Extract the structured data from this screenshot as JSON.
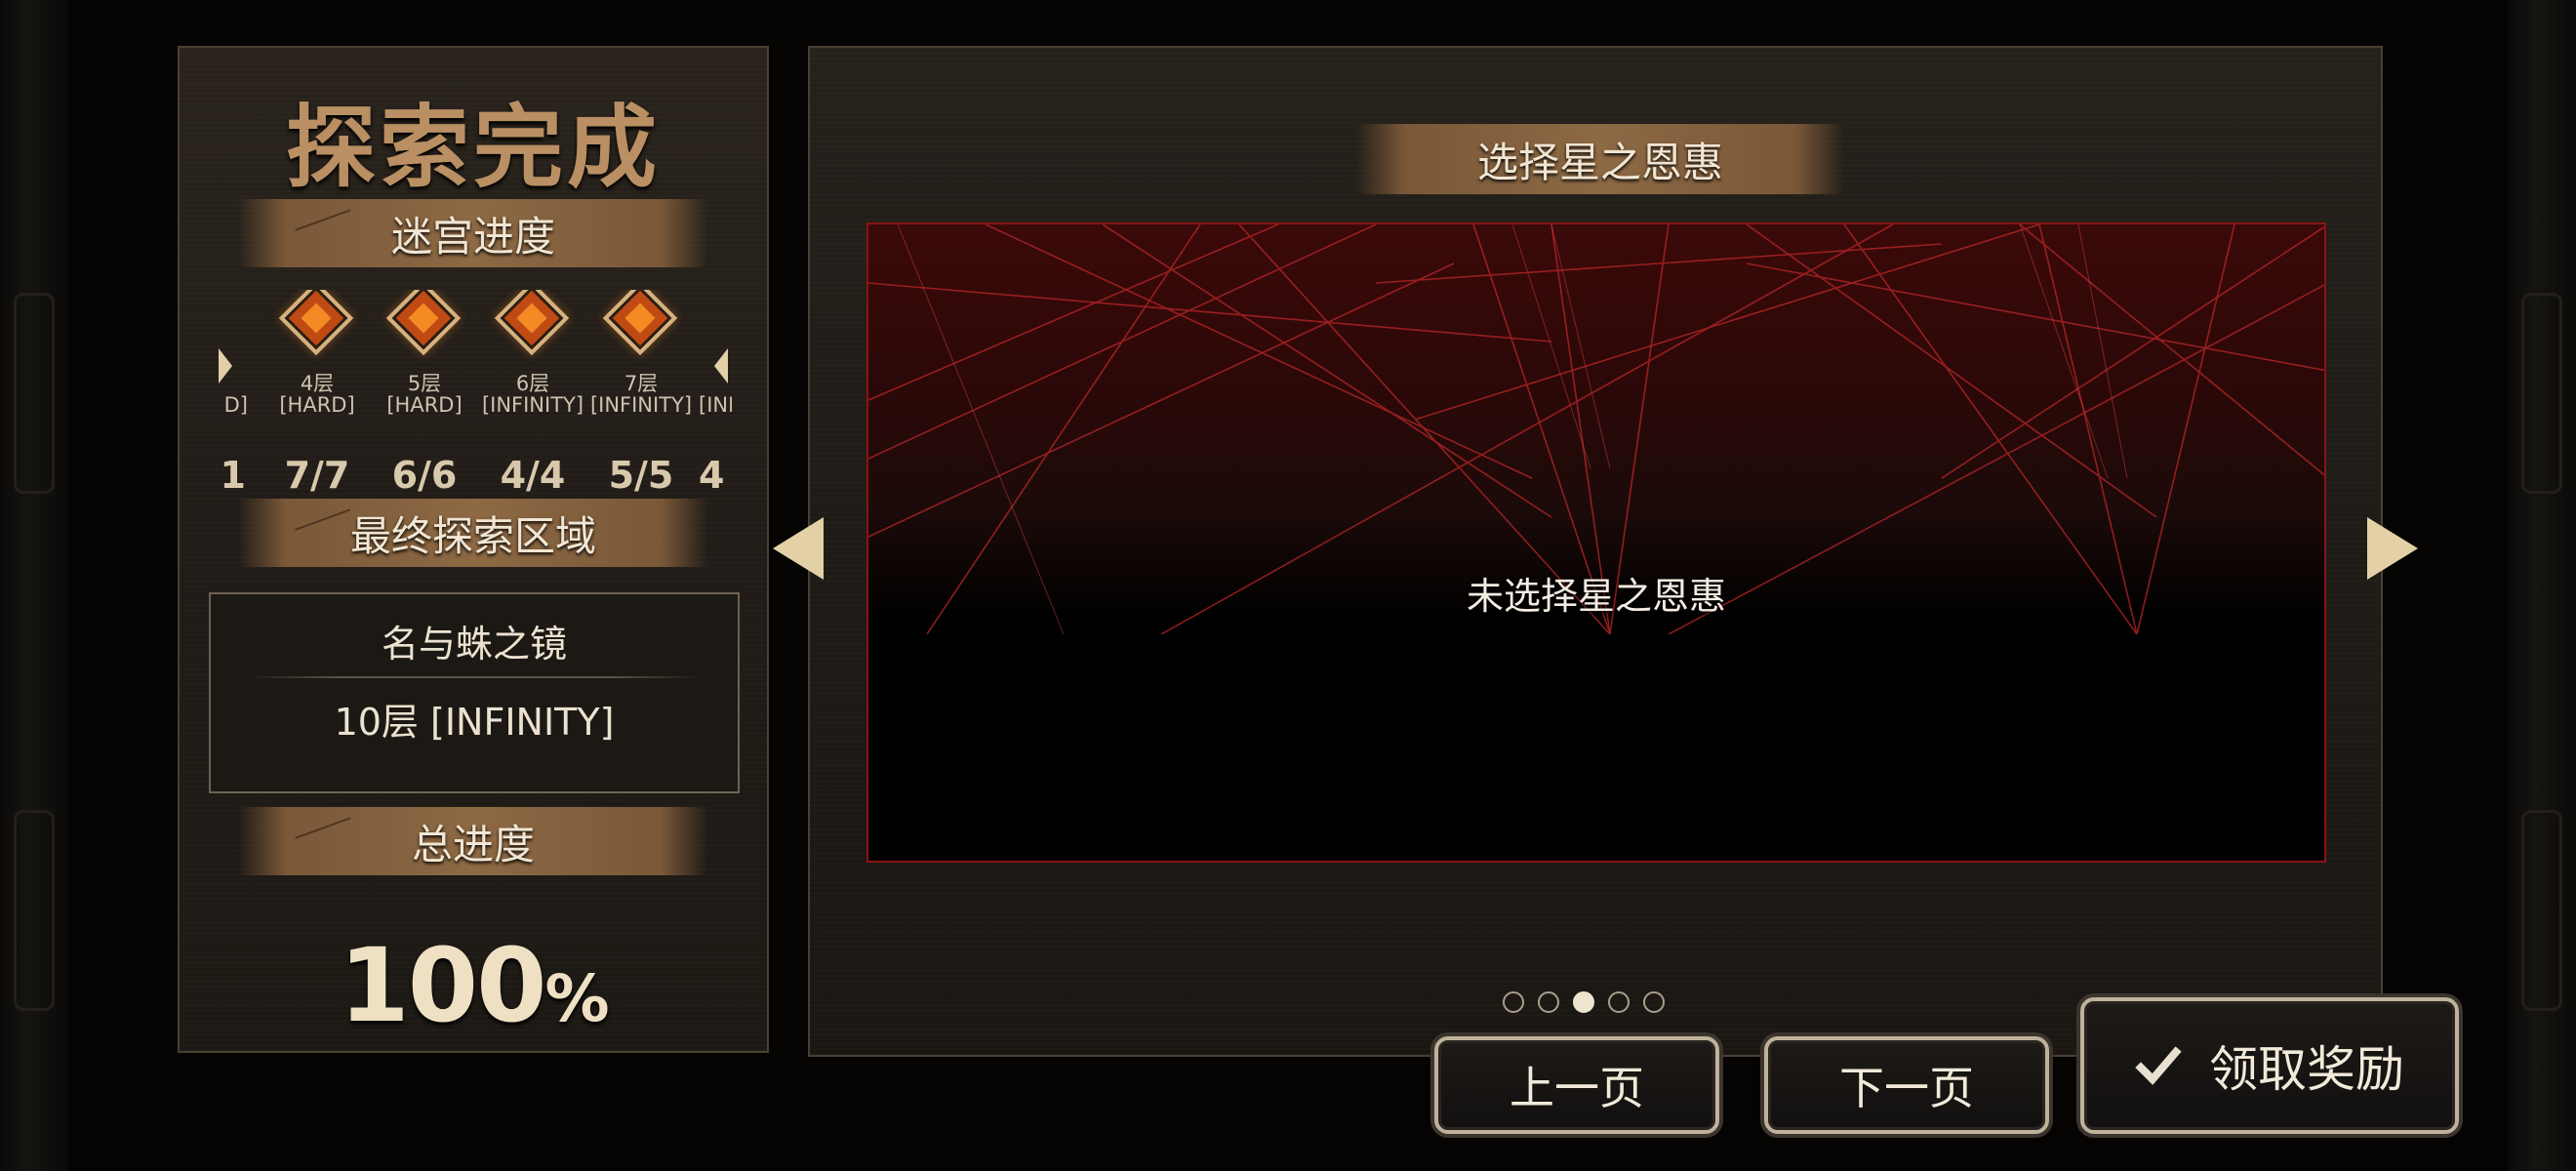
{
  "summary": {
    "title": "探索完成",
    "maze_progress_label": "迷宫进度",
    "maze_floors": [
      {
        "floor": "",
        "mode": "D]",
        "count": "1",
        "partial": "left"
      },
      {
        "floor": "4层",
        "mode": "[HARD]",
        "count": "7/7"
      },
      {
        "floor": "5层",
        "mode": "[HARD]",
        "count": "6/6"
      },
      {
        "floor": "6层",
        "mode": "[INFINITY]",
        "count": "4/4"
      },
      {
        "floor": "7层",
        "mode": "[INFINITY]",
        "count": "5/5"
      },
      {
        "floor": "",
        "mode": "[INF",
        "count": "4",
        "partial": "right"
      }
    ],
    "final_region_label": "最终探索区域",
    "final_region_name": "名与蛛之镜",
    "final_region_floor": "10层 [INFINITY]",
    "total_progress_label": "总进度",
    "total_progress_value": "100",
    "total_progress_unit": "%"
  },
  "blessing": {
    "title": "选择星之恩惠",
    "empty_text": "未选择星之恩惠"
  },
  "pagination": {
    "total": 5,
    "current": 3
  },
  "buttons": {
    "prev_page": "上一页",
    "next_page": "下一页",
    "claim": "领取奖励"
  },
  "colors": {
    "accent_brown": "#8d6944",
    "title_brown": "#b98f63",
    "blessing_border": "#8a1414",
    "gem_orange": "#c04a14"
  },
  "icons": [
    "arrow-left-icon",
    "arrow-right-icon",
    "check-icon",
    "maze-gem-icon"
  ]
}
